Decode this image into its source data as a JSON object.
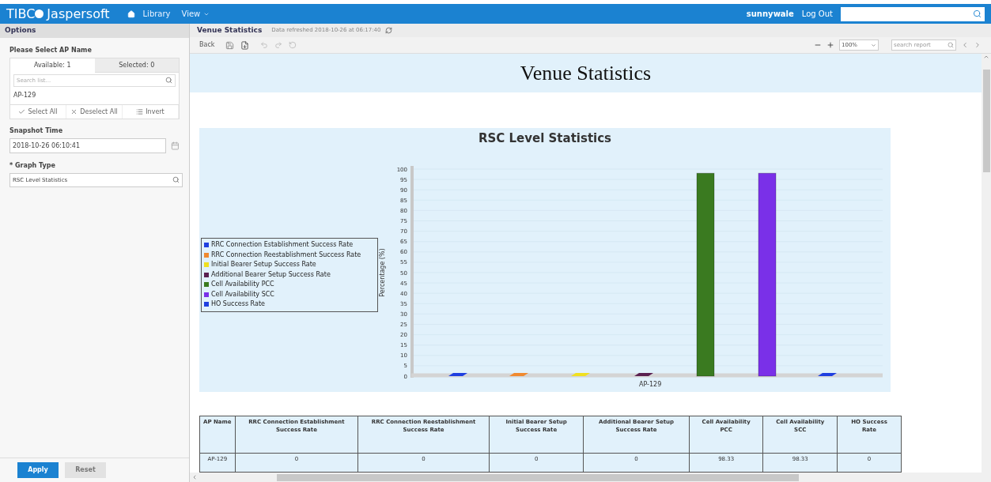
{
  "header": {
    "logo_left": "TIBC",
    "logo_right": "Jaspersoft",
    "nav": [
      {
        "kind": "home",
        "label": "Library"
      },
      {
        "kind": "menu",
        "label": "View"
      }
    ],
    "user": "sunnywale",
    "logout": "Log Out"
  },
  "options": {
    "title": "Options",
    "ap_label": "Please Select AP Name",
    "tabs": [
      {
        "label": "Available: 1",
        "selected": true
      },
      {
        "label": "Selected: 0",
        "selected": false
      }
    ],
    "list_search": {
      "placeholder": "Search list..."
    },
    "items": [
      "AP-129"
    ],
    "actions": [
      {
        "kind": "check",
        "label": "Select All"
      },
      {
        "kind": "x",
        "label": "Deselect All"
      },
      {
        "kind": "list",
        "label": "Invert"
      }
    ],
    "snapshot": {
      "label": "Snapshot Time",
      "value": "2018-10-26 06:10:41"
    },
    "graph_type": {
      "label": "* Graph Type",
      "value": "RSC Level Statistics"
    },
    "buttons": [
      {
        "label": "Apply",
        "kind": "primary"
      },
      {
        "label": "Reset",
        "kind": "secondary"
      }
    ]
  },
  "report_header": {
    "title": "Venue Statistics",
    "refreshed": "Data refreshed 2018-10-26 at 06:17:40"
  },
  "toolbar": {
    "back": "Back",
    "zoom": "100%",
    "search": {
      "placeholder": "search report"
    }
  },
  "report": {
    "title": "Venue Statistics",
    "chart_data": {
      "type": "bar",
      "title": "RSC Level Statistics",
      "grid": true,
      "legend": true,
      "ylabel": "Percentage (%)",
      "categories": [
        "AP-129"
      ],
      "ylim": [
        0,
        100
      ],
      "yticks": [
        0,
        5,
        10,
        15,
        20,
        25,
        30,
        35,
        40,
        45,
        50,
        55,
        60,
        65,
        70,
        75,
        80,
        85,
        90,
        95,
        100
      ],
      "series": [
        {
          "name": "RRC Connection Establishment Success Rate",
          "color": "#1f3fe0",
          "values": [
            0
          ]
        },
        {
          "name": "RRC Connection Reestablishment Success Rate",
          "color": "#f08a30",
          "values": [
            0
          ]
        },
        {
          "name": "Initial Bearer Setup Success Rate",
          "color": "#f0e020",
          "values": [
            0
          ]
        },
        {
          "name": "Additional Bearer Setup Success Rate",
          "color": "#5a2050",
          "values": [
            0
          ]
        },
        {
          "name": "Cell Availability PCC",
          "color": "#3a7a20",
          "values": [
            98
          ]
        },
        {
          "name": "Cell Availability SCC",
          "color": "#7a30e8",
          "values": [
            98
          ]
        },
        {
          "name": "HO Success Rate",
          "color": "#1f3fe0",
          "values": [
            0
          ]
        }
      ]
    },
    "table": {
      "columns": [
        "AP Name",
        "RRC Connection Establishment Success Rate",
        "RRC Connection Reestablishment Success Rate",
        "Initial Bearer Setup Success Rate",
        "Additional Bearer Setup Success Rate",
        "Cell Availability PCC",
        "Cell Availability SCC",
        "HO Success Rate"
      ],
      "rows": [
        [
          "AP-129",
          "0",
          "0",
          "0",
          "0",
          "98.33",
          "98.33",
          "0"
        ]
      ]
    }
  }
}
